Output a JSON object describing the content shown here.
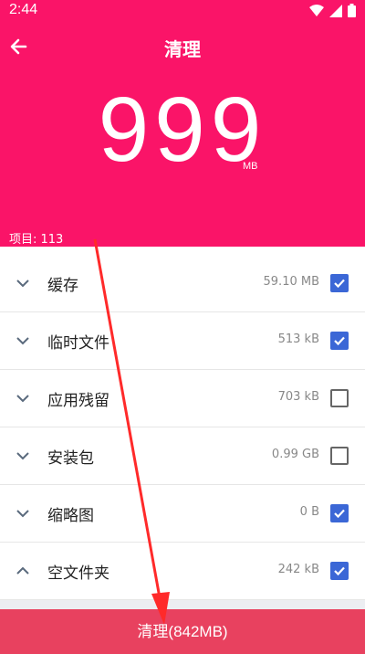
{
  "status": {
    "time": "2:44"
  },
  "header": {
    "title": "清理",
    "size_value": "999",
    "size_unit": "MB",
    "items_label": "项目: 113"
  },
  "list": [
    {
      "label": "缓存",
      "size": "59.10 MB",
      "checked": true,
      "expanded": false
    },
    {
      "label": "临时文件",
      "size": "513 kB",
      "checked": true,
      "expanded": false
    },
    {
      "label": "应用残留",
      "size": "703 kB",
      "checked": false,
      "expanded": false
    },
    {
      "label": "安装包",
      "size": "0.99 GB",
      "checked": false,
      "expanded": false
    },
    {
      "label": "缩略图",
      "size": "0 B",
      "checked": true,
      "expanded": false
    },
    {
      "label": "空文件夹",
      "size": "242 kB",
      "checked": true,
      "expanded": true
    }
  ],
  "footer": {
    "clean_button": "清理(842MB)"
  },
  "colors": {
    "accent": "#fa1468",
    "checkbox": "#3b67d6",
    "button": "#e8415f"
  }
}
